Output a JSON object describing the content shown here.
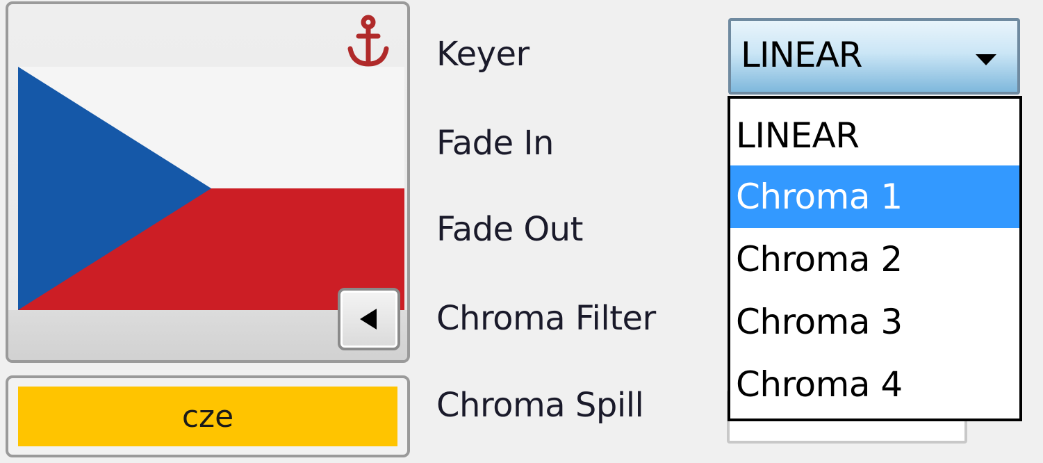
{
  "thumbnail": {
    "code": "cze",
    "flag": "czech-flag",
    "anchor_icon": "anchor-icon",
    "collapse_icon": "triangle-left-icon",
    "colors": {
      "flag_blue": "#1558a8",
      "flag_white": "#f5f5f5",
      "flag_red": "#cc1e25",
      "anchor": "#b02a2a",
      "code_bar": "#ffc400"
    }
  },
  "properties": {
    "keyer_label": "Keyer",
    "fade_in_label": "Fade In",
    "fade_out_label": "Fade Out",
    "chroma_filter_label": "Chroma Filter",
    "chroma_spill_label": "Chroma Spill"
  },
  "keyer_combo": {
    "value": "LINEAR",
    "arrow_icon": "chevron-down-icon",
    "options": [
      "LINEAR",
      "Chroma 1",
      "Chroma 2",
      "Chroma 3",
      "Chroma 4"
    ],
    "highlighted_option": "Chroma 1",
    "highlight_color": "#3399ff"
  }
}
